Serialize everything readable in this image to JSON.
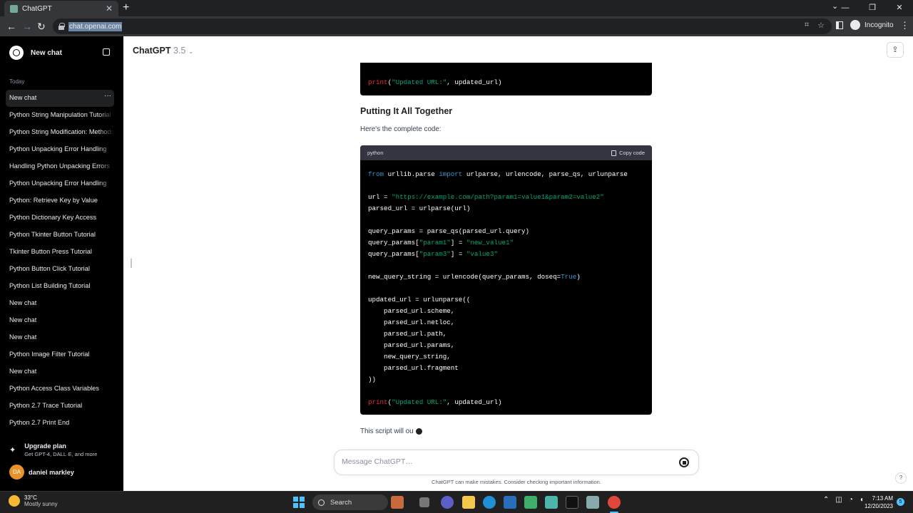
{
  "browser": {
    "tab_title": "ChatGPT",
    "tab_close": "✕",
    "new_tab": "+",
    "url": "chat.openai.com",
    "incognito_label": "Incognito",
    "window_controls": [
      "⌄",
      "—",
      "❐",
      "✕"
    ]
  },
  "sidebar": {
    "new_chat_label": "New chat",
    "section_label": "Today",
    "items": [
      "New chat",
      "Python String Manipulation Tutorial",
      "Python String Modification: Methods",
      "Python Unpacking Error Handling",
      "Handling Python Unpacking Errors",
      "Python Unpacking Error Handling",
      "Python: Retrieve Key by Value",
      "Python Dictionary Key Access",
      "Python Tkinter Button Tutorial",
      "Tkinter Button Press Tutorial",
      "Python Button Click Tutorial",
      "Python List Building Tutorial",
      "New chat",
      "New chat",
      "New chat",
      "Python Image Filter Tutorial",
      "New chat",
      "Python Access Class Variables",
      "Python 2.7 Trace Tutorial",
      "Python 2.7 Print End"
    ],
    "active_item_menu": "···",
    "upgrade_title": "Upgrade plan",
    "upgrade_subtitle": "Get GPT-4, DALL·E, and more",
    "user_initials": "DA",
    "user_name": "daniel markley"
  },
  "header": {
    "model_name": "ChatGPT",
    "model_version": "3.5",
    "model_chevron": "⌄"
  },
  "content": {
    "prev_code_line": {
      "fn": "print",
      "open": "(",
      "str": "\"Updated URL:\"",
      "rest": ", updated_url)"
    },
    "heading": "Putting It All Together",
    "intro": "Here's the complete code:",
    "code_language": "python",
    "copy_label": "Copy code",
    "code": {
      "l1_kw1": "from",
      "l1_mid": " urllib.parse ",
      "l1_kw2": "import",
      "l1_rest": " urlparse, urlencode, parse_qs, urlunparse",
      "l2_a": "url = ",
      "l2_str": "\"https://example.com/path?param1=value1&param2=value2\"",
      "l3": "parsed_url = urlparse(url)",
      "l4": "query_params = parse_qs(parsed_url.query)",
      "l5_a": "query_params[",
      "l5_key": "\"param1\"",
      "l5_b": "] = ",
      "l5_val": "\"new_value1\"",
      "l6_a": "query_params[",
      "l6_key": "\"param3\"",
      "l6_b": "] = ",
      "l6_val": "\"value3\"",
      "l7_a": "new_query_string = urlencode(query_params, doseq=",
      "l7_kw": "True",
      "l7_b": ")",
      "l8": "updated_url = urlunparse((",
      "l9": "    parsed_url.scheme,",
      "l10": "    parsed_url.netloc,",
      "l11": "    parsed_url.path,",
      "l12": "    parsed_url.params,",
      "l13": "    new_query_string,",
      "l14": "    parsed_url.fragment",
      "l15": "))",
      "l16_fn": "print",
      "l16_open": "(",
      "l16_str": "\"Updated URL:\"",
      "l16_rest": ", updated_url)"
    },
    "streaming_text": "This script will ou"
  },
  "composer": {
    "placeholder": "Message ChatGPT…",
    "disclaimer": "ChatGPT can make mistakes. Consider checking important information."
  },
  "help_label": "?",
  "taskbar": {
    "weather_temp": "33°C",
    "weather_desc": "Mostly sunny",
    "search_label": "Search",
    "time": "7:13 AM",
    "date": "12/20/2023",
    "notification_count": "5",
    "tray_chevron": "⌃"
  },
  "colors": {
    "sidebar_bg": "#000000",
    "code_bg": "#000000",
    "code_keyword": "#2e95d3",
    "code_string": "#00a67d",
    "code_function": "#f22c3d"
  }
}
